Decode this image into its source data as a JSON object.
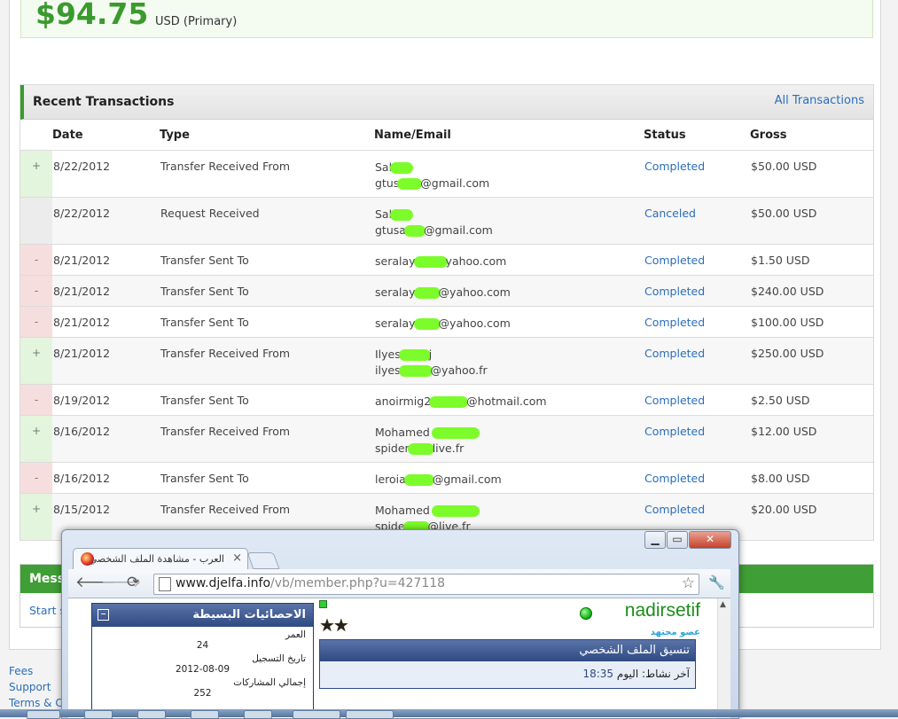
{
  "balance": {
    "amount": "$94.75",
    "currency": "USD (Primary)"
  },
  "transactions": {
    "title": "Recent Transactions",
    "all_link": "All Transactions",
    "columns": {
      "date": "Date",
      "type": "Type",
      "name": "Name/Email",
      "status": "Status",
      "gross": "Gross"
    },
    "rows": [
      {
        "sign": "+",
        "date": "8/22/2012",
        "type": "Transfer Received From",
        "name1": "Sal",
        "name2a": "gtus",
        "name2b": "@gmail.com",
        "status": "Completed",
        "gross": "$50.00 USD"
      },
      {
        "sign": "",
        "date": "8/22/2012",
        "type": "Request Received",
        "name1": "Sal",
        "name2a": "gtusa",
        "name2b": "@gmail.com",
        "status": "Canceled",
        "gross": "$50.00 USD"
      },
      {
        "sign": "-",
        "date": "8/21/2012",
        "type": "Transfer Sent To",
        "name1a": "seralay",
        "name1b": "yahoo.com",
        "status": "Completed",
        "gross": "$1.50 USD"
      },
      {
        "sign": "-",
        "date": "8/21/2012",
        "type": "Transfer Sent To",
        "name1a": "seralay",
        "name1b": "@yahoo.com",
        "status": "Completed",
        "gross": "$240.00 USD"
      },
      {
        "sign": "-",
        "date": "8/21/2012",
        "type": "Transfer Sent To",
        "name1a": "seralay",
        "name1b": "@yahoo.com",
        "status": "Completed",
        "gross": "$100.00 USD"
      },
      {
        "sign": "+",
        "date": "8/21/2012",
        "type": "Transfer Received From",
        "name1": "Ilyes",
        "name1b": "j",
        "name2a": "ilyes",
        "name2b": "@yahoo.fr",
        "status": "Completed",
        "gross": "$250.00 USD"
      },
      {
        "sign": "-",
        "date": "8/19/2012",
        "type": "Transfer Sent To",
        "name1a": "anoirmig2",
        "name1b": "@hotmail.com",
        "status": "Completed",
        "gross": "$2.50 USD"
      },
      {
        "sign": "+",
        "date": "8/16/2012",
        "type": "Transfer Received From",
        "name1": "Mohamed",
        "name2a": "spider",
        "name2b": "live.fr",
        "status": "Completed",
        "gross": "$12.00 USD"
      },
      {
        "sign": "-",
        "date": "8/16/2012",
        "type": "Transfer Sent To",
        "name1a": "leroia",
        "name1b": "@gmail.com",
        "status": "Completed",
        "gross": "$8.00 USD"
      },
      {
        "sign": "+",
        "date": "8/15/2012",
        "type": "Transfer Received From",
        "name1": "Mohamed",
        "name2a": "spide",
        "name2b": "@live.fr",
        "status": "Completed",
        "gross": "$20.00 USD"
      }
    ]
  },
  "messages": {
    "title": "Messa",
    "link": "Start s"
  },
  "footer": {
    "fees": "Fees",
    "support": "Support",
    "terms": "Terms & Co"
  },
  "browser": {
    "tab_title": "العرب - مشاهدة الملف الشخصي",
    "tab_close": "×",
    "url_host": "www.djelfa.info",
    "url_path": "/vb/member.php?u=427118",
    "stats_title": "الاحصائيات البسيطة",
    "collapse": "−",
    "stats": [
      {
        "label": "العمر",
        "value": "24"
      },
      {
        "label": "تاريخ التسجيل",
        "value": "2012-08-09"
      },
      {
        "label": "إجمالي المشاركات",
        "value": "252"
      }
    ],
    "username": "nadirsetif",
    "rank": "عضو مجتهد",
    "stars": "★★",
    "profile_button": "تنسيق الملف الشخصي",
    "last_activity_label": "آخر نشاط: اليوم",
    "last_activity_time": "18:35"
  },
  "colors": {
    "accent_green": "#3a9a2e",
    "link_blue": "#2a6ebb",
    "censor_green": "#7cfc2a"
  }
}
